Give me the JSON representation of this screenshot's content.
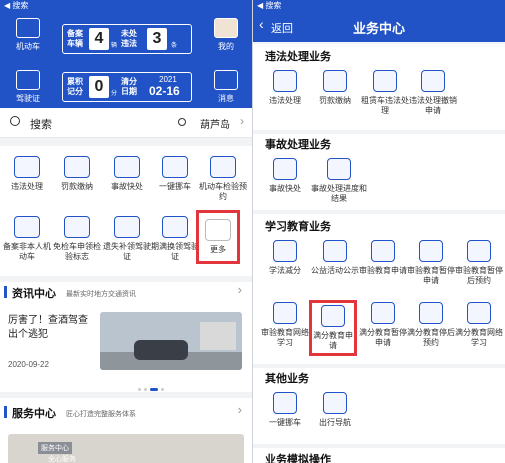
{
  "status_bar": {
    "back_label": "◀ 搜索"
  },
  "left": {
    "header": {
      "vehicle_label": "机动车",
      "license_label": "驾驶证",
      "mine_label": "我的",
      "message_label": "消息",
      "card1": {
        "label": "备案车辆",
        "count": "4",
        "unit": "辆",
        "mid_label": "未处违法",
        "value": "3",
        "unit2": "条"
      },
      "card2": {
        "label": "累积记分",
        "count": "0",
        "unit": "分",
        "mid_label": "清分日期",
        "year": "2021",
        "date": "02-16"
      }
    },
    "search": {
      "placeholder": "搜索",
      "city": "葫芦岛"
    },
    "grid": [
      {
        "label": "违法处理"
      },
      {
        "label": "罚款缴纳"
      },
      {
        "label": "事故快处"
      },
      {
        "label": "一键挪车"
      },
      {
        "label": "机动车检验预约"
      },
      {
        "label": "备案非本人机动车"
      },
      {
        "label": "免检车申领检验标志"
      },
      {
        "label": "遗失补领驾驶证"
      },
      {
        "label": "期满换领驾驶证"
      },
      {
        "label": "更多"
      }
    ],
    "news": {
      "title": "资讯中心",
      "subtitle": "最新实时地方交通资讯",
      "headline": "厉害了！查酒驾查出个逃犯",
      "date": "2020-09-22"
    },
    "service": {
      "title": "服务中心",
      "subtitle": "匠心打造完整服务体系",
      "badge": "服务中心",
      "badge2": "全心服务"
    }
  },
  "right": {
    "header": {
      "back_label": "返回",
      "title": "业务中心"
    },
    "sections": {
      "s1": {
        "title": "违法处理业务",
        "items": [
          "违法处理",
          "罚款缴纳",
          "租赁车违法处理",
          "违法处理撤销申请"
        ]
      },
      "s2": {
        "title": "事故处理业务",
        "items": [
          "事故快处",
          "事故处理进度和结果"
        ]
      },
      "s3": {
        "title": "学习教育业务",
        "items": [
          "学法减分",
          "公益活动公示",
          "审验教育申请",
          "审验教育暂停申请",
          "审验教育暂停后预约",
          "审验教育网络学习",
          "满分教育申请",
          "满分教育暂停申请",
          "满分教育停后预约",
          "满分教育网络学习"
        ]
      },
      "s4": {
        "title": "其他业务",
        "items": [
          "一键挪车",
          "出行导航"
        ]
      },
      "s5": {
        "title": "业务模拟操作"
      }
    }
  },
  "colors": {
    "brand": "#2153c6",
    "highlight": "#e2353c"
  }
}
